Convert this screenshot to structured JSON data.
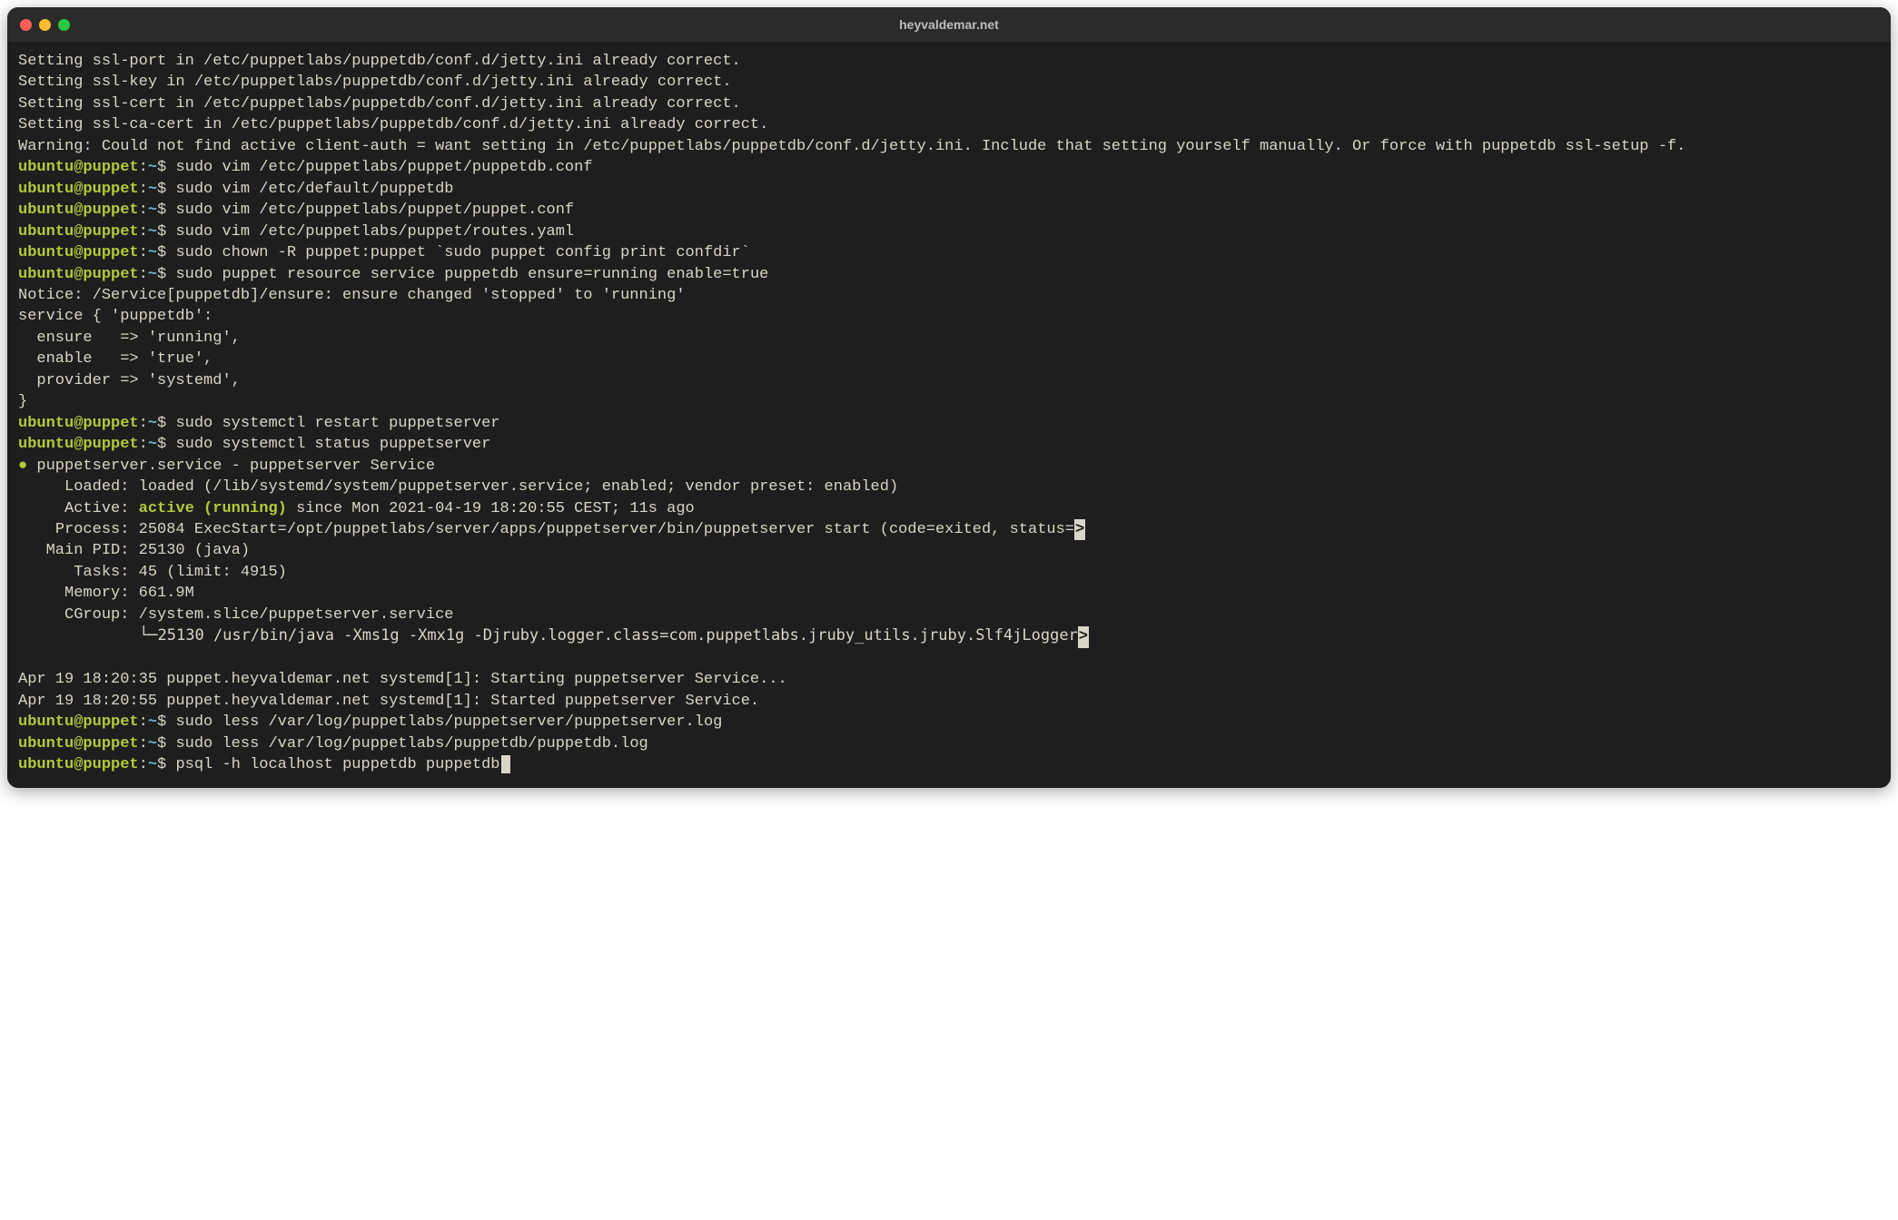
{
  "window": {
    "title": "heyvaldemar.net"
  },
  "prompt": {
    "user": "ubuntu",
    "host": "puppet",
    "path": "~",
    "symbol": "$"
  },
  "output": {
    "pre": [
      "Setting ssl-port in /etc/puppetlabs/puppetdb/conf.d/jetty.ini already correct.",
      "Setting ssl-key in /etc/puppetlabs/puppetdb/conf.d/jetty.ini already correct.",
      "Setting ssl-cert in /etc/puppetlabs/puppetdb/conf.d/jetty.ini already correct.",
      "Setting ssl-ca-cert in /etc/puppetlabs/puppetdb/conf.d/jetty.ini already correct.",
      "Warning: Could not find active client-auth = want setting in /etc/puppetlabs/puppetdb/conf.d/jetty.ini. Include that setting yourself manually. Or force with puppetdb ssl-setup -f."
    ],
    "cmd1": "sudo vim /etc/puppetlabs/puppet/puppetdb.conf",
    "cmd2": "sudo vim /etc/default/puppetdb",
    "cmd3": "sudo vim /etc/puppetlabs/puppet/puppet.conf",
    "cmd4": "sudo vim /etc/puppetlabs/puppet/routes.yaml",
    "cmd5": "sudo chown -R puppet:puppet `sudo puppet config print confdir`",
    "cmd6": "sudo puppet resource service puppetdb ensure=running enable=true",
    "resource_out": [
      "Notice: /Service[puppetdb]/ensure: ensure changed 'stopped' to 'running'",
      "service { 'puppetdb':",
      "  ensure   => 'running',",
      "  enable   => 'true',",
      "  provider => 'systemd',",
      "}"
    ],
    "cmd7": "sudo systemctl restart puppetserver",
    "cmd8": "sudo systemctl status puppetserver",
    "status": {
      "bullet": "●",
      "header": "puppetserver.service - puppetserver Service",
      "loaded": "     Loaded: loaded (/lib/systemd/system/puppetserver.service; enabled; vendor preset: enabled)",
      "active_label": "     Active: ",
      "active_value": "active (running)",
      "active_rest": " since Mon 2021-04-19 18:20:55 CEST; 11s ago",
      "process": "    Process: 25084 ExecStart=/opt/puppetlabs/server/apps/puppetserver/bin/puppetserver start (code=exited, status=",
      "mainpid": "   Main PID: 25130 (java)",
      "tasks": "      Tasks: 45 (limit: 4915)",
      "memory": "     Memory: 661.9M",
      "cgroup": "     CGroup: /system.slice/puppetserver.service",
      "tree": "             └─25130 /usr/bin/java -Xms1g -Xmx1g -Djruby.logger.class=com.puppetlabs.jruby_utils.jruby.Slf4jLogger",
      "trunc": ">"
    },
    "journal": [
      "Apr 19 18:20:35 puppet.heyvaldemar.net systemd[1]: Starting puppetserver Service...",
      "Apr 19 18:20:55 puppet.heyvaldemar.net systemd[1]: Started puppetserver Service."
    ],
    "cmd9": "sudo less /var/log/puppetlabs/puppetserver/puppetserver.log",
    "cmd10": "sudo less /var/log/puppetlabs/puppetdb/puppetdb.log",
    "cmd11": "psql -h localhost puppetdb puppetdb"
  }
}
